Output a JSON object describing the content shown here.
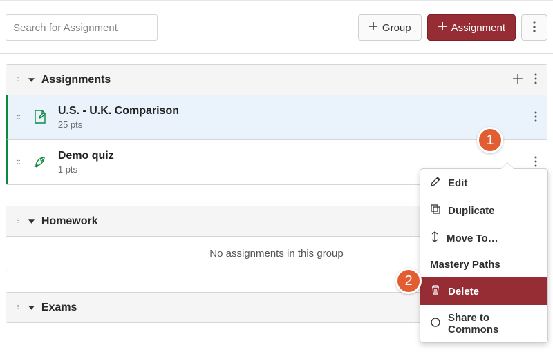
{
  "toolbar": {
    "search_placeholder": "Search for Assignment",
    "group_button": "Group",
    "assignment_button": "Assignment"
  },
  "groups": [
    {
      "title": "Assignments",
      "items": [
        {
          "title": "U.S. - U.K. Comparison",
          "meta": "25 pts",
          "icon": "paper",
          "selected": true
        },
        {
          "title": "Demo quiz",
          "meta": "1 pts",
          "icon": "rocket",
          "selected": false
        }
      ]
    },
    {
      "title": "Homework",
      "empty_text": "No assignments in this group",
      "items": []
    },
    {
      "title": "Exams",
      "items": []
    }
  ],
  "menu": {
    "edit": "Edit",
    "duplicate": "Duplicate",
    "move_to": "Move To…",
    "mastery_paths": "Mastery Paths",
    "delete": "Delete",
    "share": "Share to Commons"
  },
  "callouts": {
    "1": "1",
    "2": "2"
  }
}
